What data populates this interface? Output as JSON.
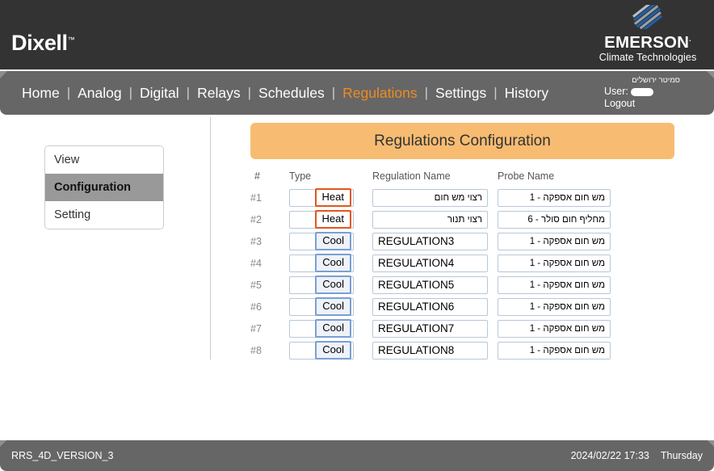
{
  "header": {
    "brand": "Dixell",
    "brand_tm": "™",
    "emerson_name": "EMERSON",
    "emerson_reg": ".",
    "emerson_tagline": "Climate Technologies",
    "bg_color": "#333333"
  },
  "nav": {
    "separator": "|",
    "active_color": "#ee8b22",
    "items": [
      {
        "label": "Home",
        "active": false
      },
      {
        "label": "Analog",
        "active": false
      },
      {
        "label": "Digital",
        "active": false
      },
      {
        "label": "Relays",
        "active": false
      },
      {
        "label": "Schedules",
        "active": false
      },
      {
        "label": "Regulations",
        "active": true
      },
      {
        "label": "Settings",
        "active": false
      },
      {
        "label": "History",
        "active": false
      }
    ]
  },
  "user": {
    "site_name": "סמיטר ירושלים",
    "user_label": "User:",
    "user_value": "",
    "logout_label": "Logout"
  },
  "sidebar": {
    "items": [
      {
        "label": "View",
        "selected": false
      },
      {
        "label": "Configuration",
        "selected": true
      },
      {
        "label": "Setting",
        "selected": false
      }
    ]
  },
  "main": {
    "panel_title": "Regulations Configuration",
    "panel_title_bg": "#f7bc72",
    "columns": [
      "#",
      "Type",
      "Regulation Name",
      "Probe Name"
    ],
    "heat_color": "#e2571e",
    "cool_color": "#7a9fd4",
    "rows": [
      {
        "num": "#1",
        "type": "Heat",
        "mode": "heat",
        "name": "רצוי מש חום",
        "name_dir": "rtl",
        "probe": "מש חום אספקה - 1"
      },
      {
        "num": "#2",
        "type": "Heat",
        "mode": "heat",
        "name": "רצוי תנור",
        "name_dir": "rtl",
        "probe": "מחליף חום סולר - 6"
      },
      {
        "num": "#3",
        "type": "Cool",
        "mode": "cool",
        "name": "REGULATION3",
        "name_dir": "ltr",
        "probe": "מש חום אספקה - 1"
      },
      {
        "num": "#4",
        "type": "Cool",
        "mode": "cool",
        "name": "REGULATION4",
        "name_dir": "ltr",
        "probe": "מש חום אספקה - 1"
      },
      {
        "num": "#5",
        "type": "Cool",
        "mode": "cool",
        "name": "REGULATION5",
        "name_dir": "ltr",
        "probe": "מש חום אספקה - 1"
      },
      {
        "num": "#6",
        "type": "Cool",
        "mode": "cool",
        "name": "REGULATION6",
        "name_dir": "ltr",
        "probe": "מש חום אספקה - 1"
      },
      {
        "num": "#7",
        "type": "Cool",
        "mode": "cool",
        "name": "REGULATION7",
        "name_dir": "ltr",
        "probe": "מש חום אספקה - 1"
      },
      {
        "num": "#8",
        "type": "Cool",
        "mode": "cool",
        "name": "REGULATION8",
        "name_dir": "ltr",
        "probe": "מש חום אספקה - 1"
      }
    ]
  },
  "footer": {
    "version": "RRS_4D_VERSION_3",
    "datetime": "2024/02/22 17:33",
    "weekday": "Thursday",
    "bg_color": "#666666"
  }
}
